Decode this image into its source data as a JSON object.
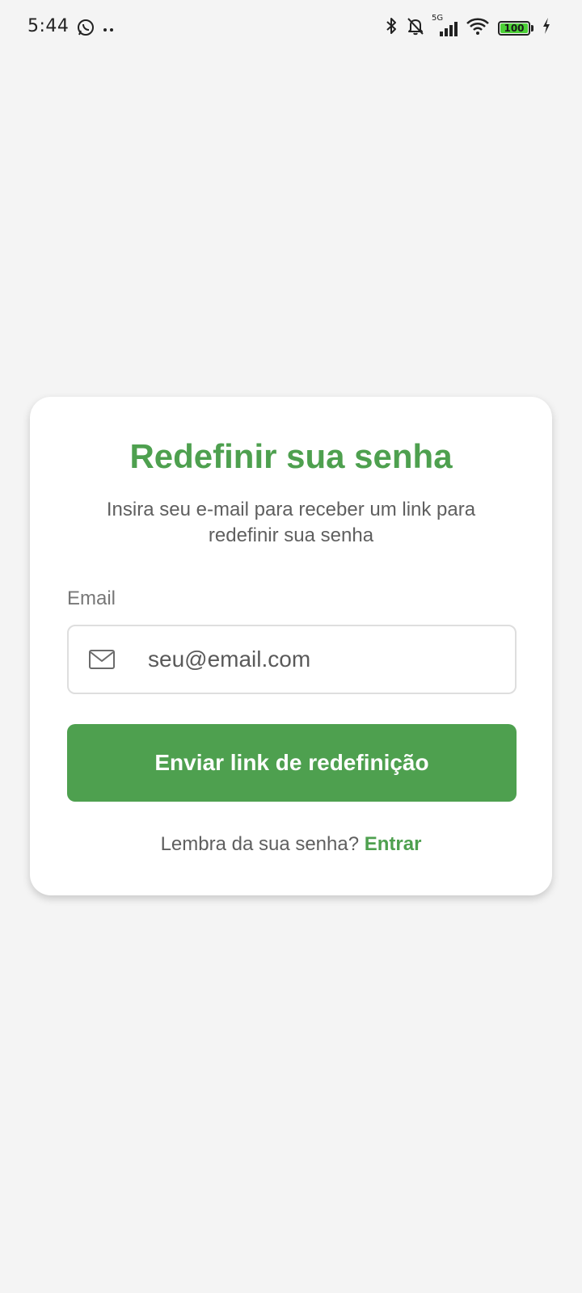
{
  "status_bar": {
    "time": "5:44",
    "network_type": "5G",
    "battery_level": "100",
    "icons": [
      "whatsapp-icon",
      "more-dots-icon",
      "bluetooth-icon",
      "bell-off-icon",
      "signal-icon",
      "wifi-icon",
      "battery-icon",
      "charging-icon"
    ]
  },
  "card": {
    "title": "Redefinir sua senha",
    "subtitle": "Insira seu e-mail para receber um link para redefinir sua senha",
    "email_label": "Email",
    "email_placeholder": "seu@email.com",
    "email_value": "",
    "submit_label": "Enviar link de redefinição",
    "footer_prompt": "Lembra da sua senha?",
    "footer_link": "Entrar"
  },
  "colors": {
    "accent": "#4ea04f",
    "background": "#f4f4f4",
    "card": "#ffffff"
  }
}
